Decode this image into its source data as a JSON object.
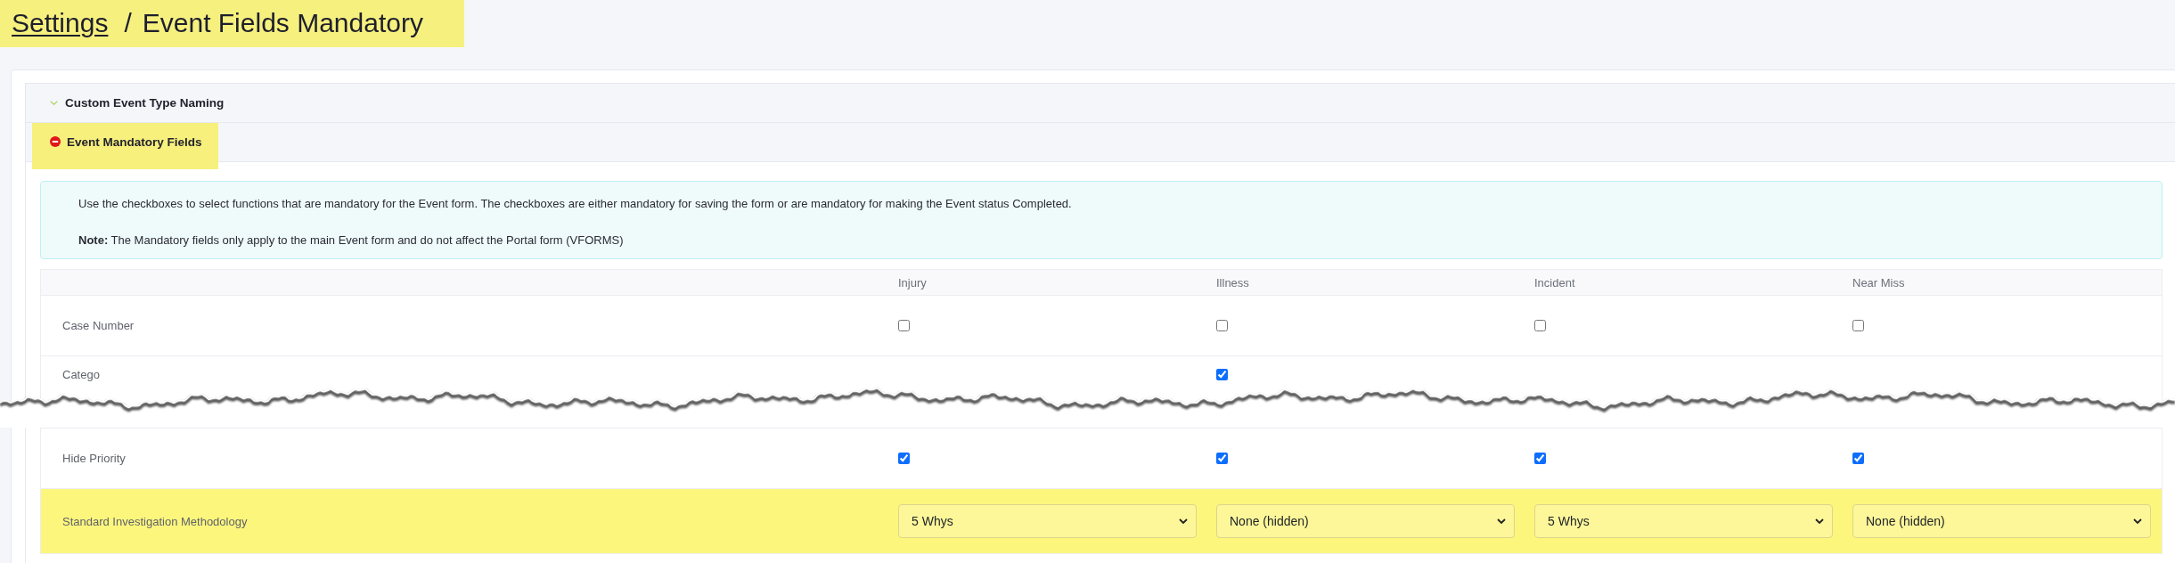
{
  "breadcrumb": {
    "highlighted": true,
    "items": [
      {
        "kind": "link",
        "label": "Settings"
      },
      {
        "kind": "current",
        "label": "Event Fields Mandatory"
      }
    ],
    "separator": "/"
  },
  "accordion": {
    "sections": [
      {
        "title": "Custom Event Type Naming",
        "expanded": false,
        "highlighted": false
      },
      {
        "title": "Event Mandatory Fields",
        "expanded": true,
        "highlighted": true,
        "info": {
          "text": "Use the checkboxes to select functions that are mandatory for the Event form. The checkboxes are either mandatory for saving the form or are mandatory for making the Event status Completed.",
          "note": "**Note:** The Mandatory fields only apply to the main Event form and do not affect the Portal form (VFORMS)"
        },
        "table": {
          "columns": [
            "Injury",
            "Illness",
            "Incident",
            "Near Miss"
          ],
          "rows": [
            {
              "kind": "checkbox",
              "label": "Case Number",
              "highlighted": false,
              "cut_off": false,
              "cells": [
                {
                  "checked": false
                },
                {
                  "checked": false
                },
                {
                  "checked": false
                },
                {
                  "checked": false
                }
              ]
            },
            {
              "kind": "checkbox",
              "label": "Catego",
              "highlighted": false,
              "cut_off": true,
              "cells": [
                null,
                {
                  "checked": true
                },
                null,
                null
              ]
            },
            {
              "kind": "checkbox",
              "label": "Hide Priority",
              "highlighted": false,
              "cut_off": false,
              "cells": [
                {
                  "checked": true
                },
                {
                  "checked": true
                },
                {
                  "checked": true
                },
                {
                  "checked": true
                }
              ]
            },
            {
              "kind": "select",
              "label": "Standard Investigation Methodology",
              "highlighted": true,
              "cut_off": false,
              "cells": [
                {
                  "value": "5 Whys"
                },
                {
                  "value": "None (hidden)"
                },
                {
                  "value": "5 Whys"
                },
                {
                  "value": "None (hidden)"
                }
              ]
            }
          ]
        }
      }
    ]
  }
}
